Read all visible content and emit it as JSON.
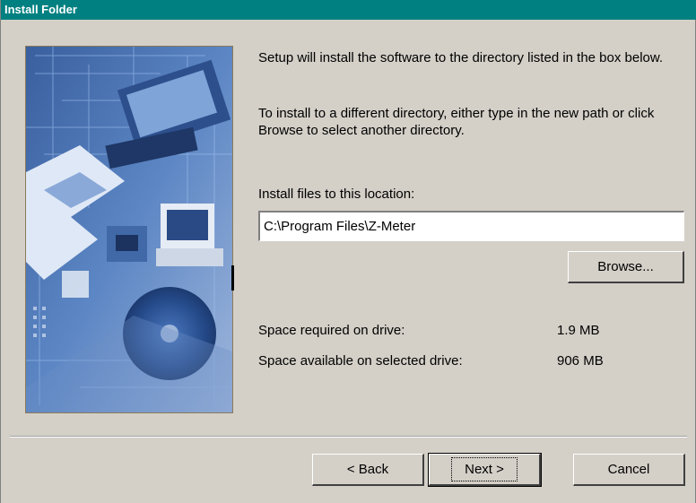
{
  "window": {
    "title": "Install Folder"
  },
  "description": {
    "line1": "Setup will install the software to the directory listed in the box below.",
    "line2": "To install to a different directory, either type in the new path or click Browse to select another directory."
  },
  "location": {
    "label": "Install files to this location:",
    "value": "C:\\Program Files\\Z-Meter"
  },
  "buttons": {
    "browse": "Browse...",
    "back": "< Back",
    "next": "Next >",
    "cancel": "Cancel"
  },
  "space": {
    "required_label": "Space required on drive:",
    "required_value": "1.9 MB",
    "available_label": "Space available on selected drive:",
    "available_value": "906 MB"
  },
  "colors": {
    "titlebar": "#008080",
    "dialog_bg": "#d4d0c8"
  }
}
